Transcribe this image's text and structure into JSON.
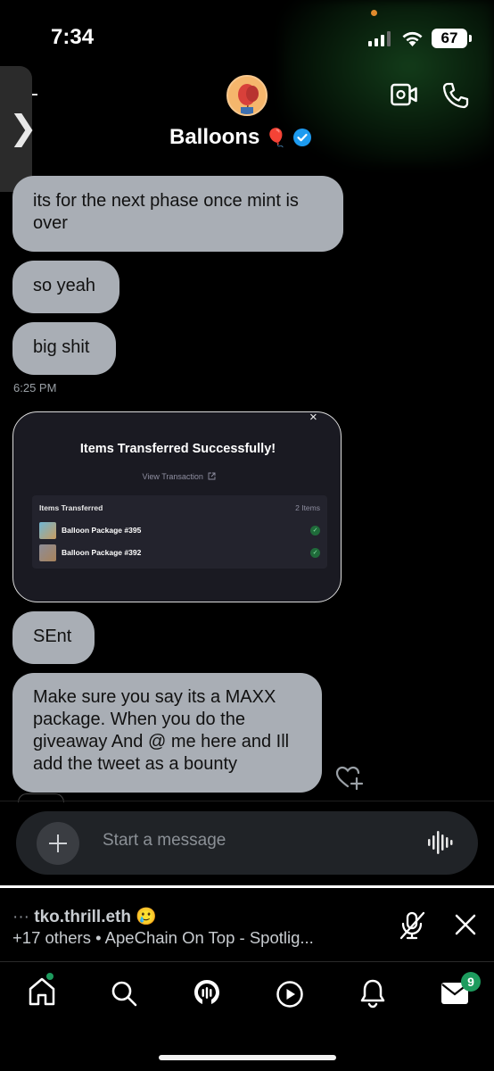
{
  "status_bar": {
    "time": "7:34",
    "battery": "67"
  },
  "header": {
    "title": "Balloons",
    "title_emoji": "🎈"
  },
  "messages": [
    {
      "text": "its for the next phase once mint is over"
    },
    {
      "text": "so yeah"
    },
    {
      "text": "big shit"
    }
  ],
  "timestamp": "6:25 PM",
  "card": {
    "title": "Items Transferred Successfully!",
    "link": "View Transaction",
    "panel_title": "Items Transferred",
    "panel_count": "2 Items",
    "items": [
      {
        "name": "Balloon Package #395"
      },
      {
        "name": "Balloon Package #392"
      }
    ],
    "close": "×"
  },
  "messages_after": [
    {
      "text": "SEnt"
    },
    {
      "text": "Make sure you say its a MAXX package. When you do the giveaway And @ me here and Ill add the tweet as a bounty"
    }
  ],
  "composer": {
    "placeholder": "Start a message"
  },
  "space": {
    "dots": "···",
    "host": "tko.thrill.eth",
    "host_emoji": "🥲",
    "subtitle": "+17 others • ApeChain On Top - Spotlig..."
  },
  "tabs": {
    "mail_badge": "9"
  },
  "colors": {
    "bubble": "#a9aeb5",
    "accent_green": "#1d9b5e",
    "verified": "#1d9bf0"
  }
}
